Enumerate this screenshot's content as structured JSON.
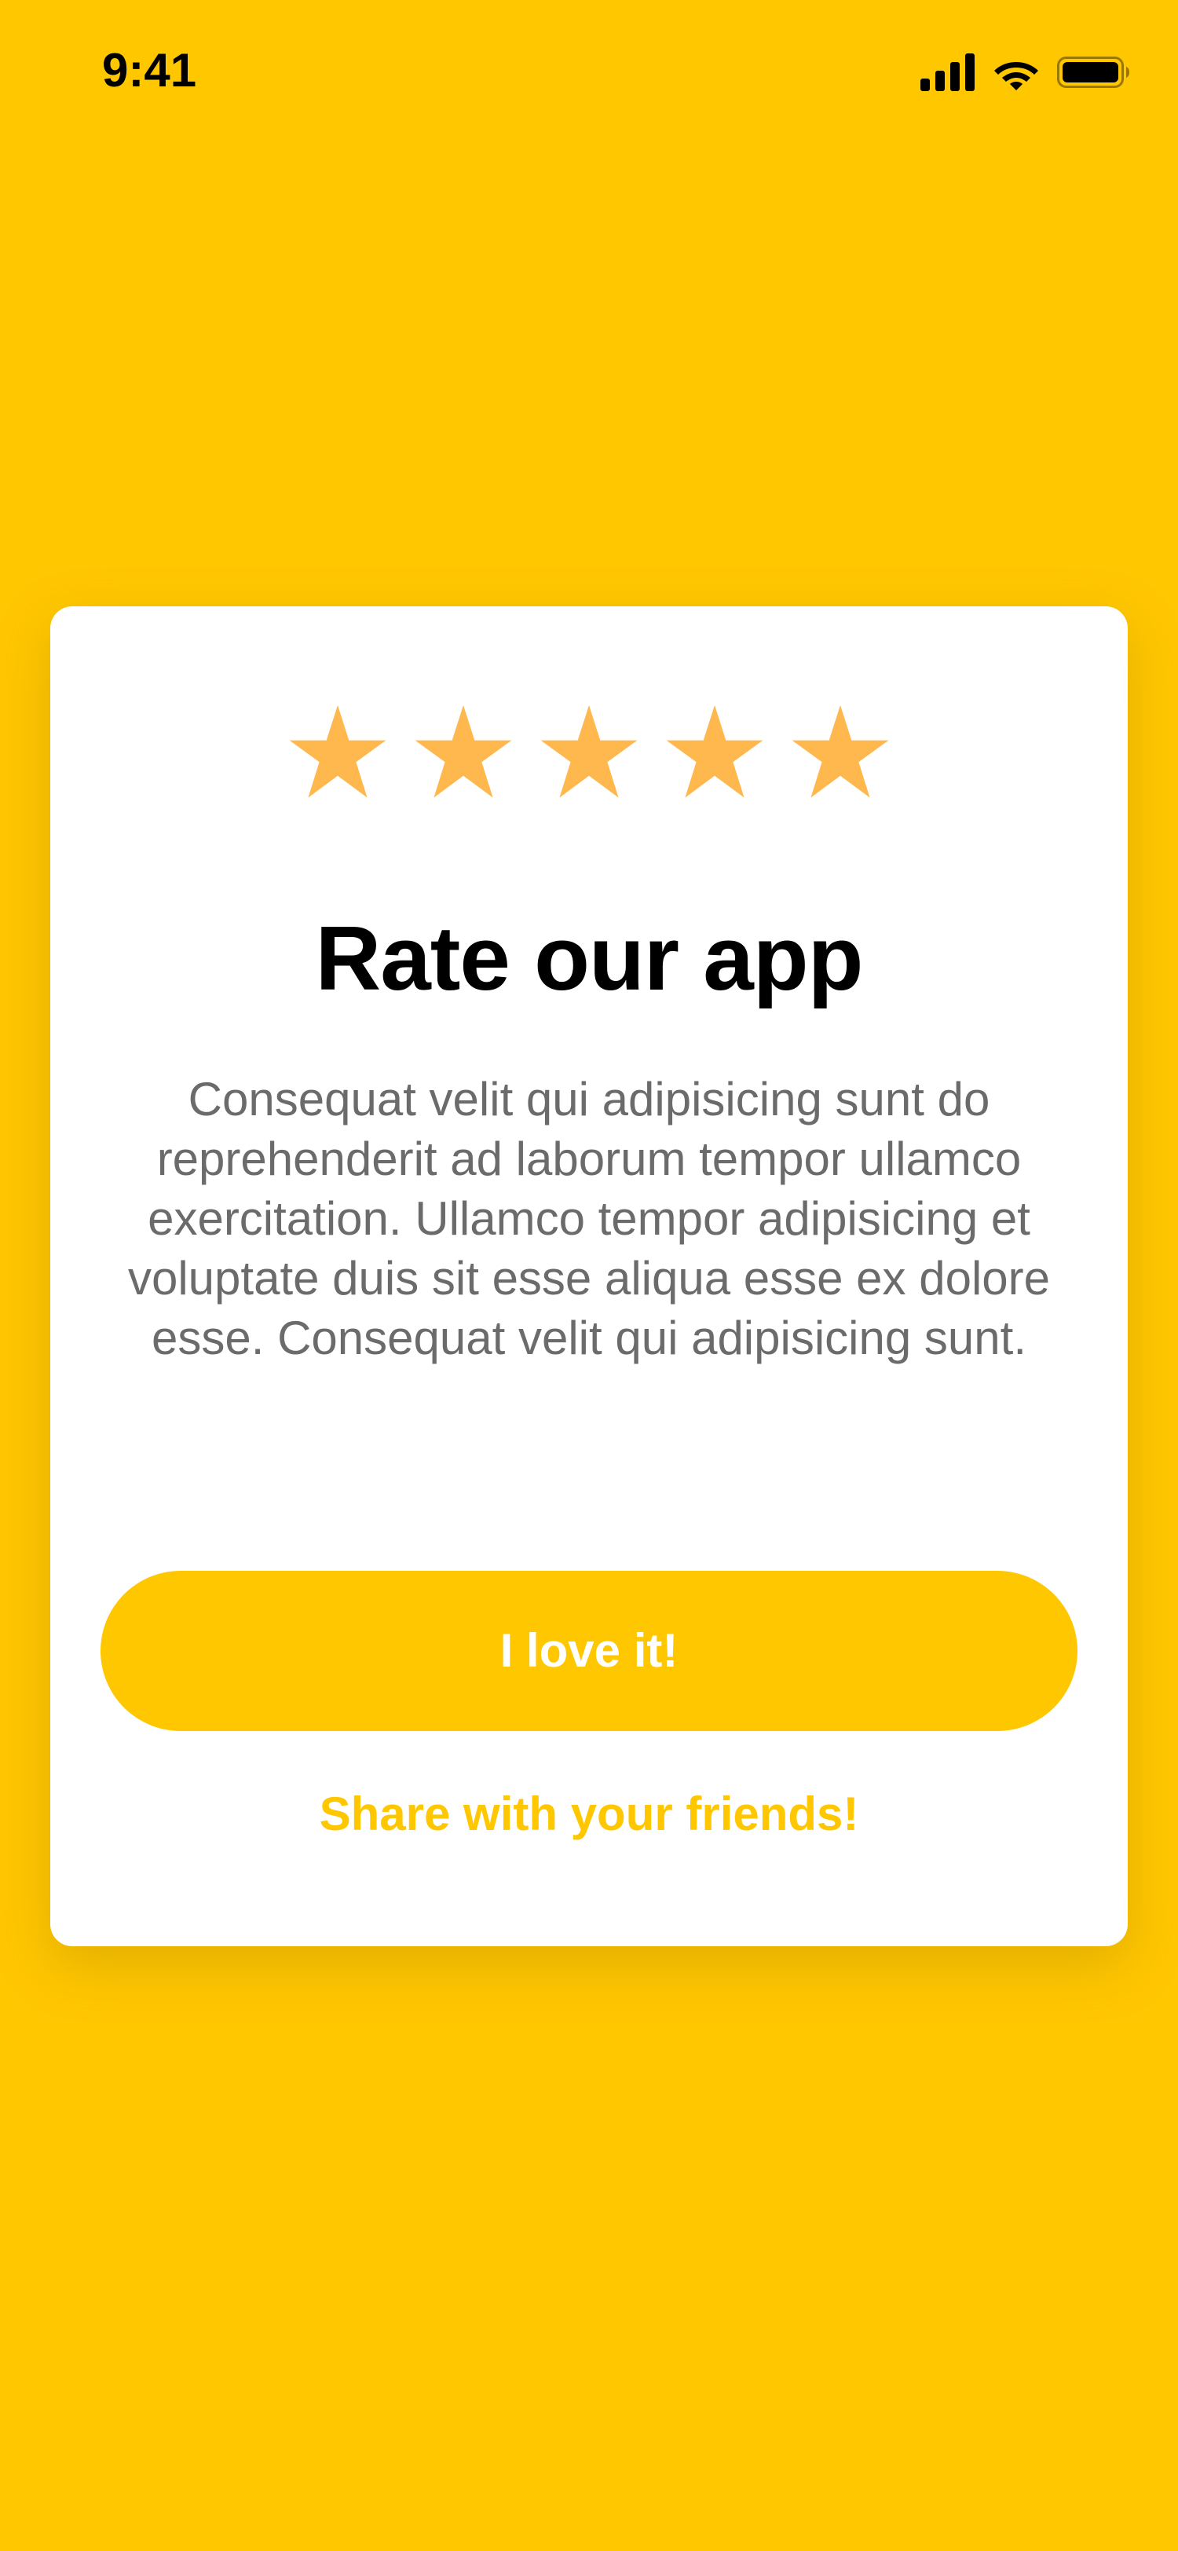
{
  "status_bar": {
    "time": "9:41",
    "icons": [
      "cellular-signal-icon",
      "wifi-icon",
      "battery-icon"
    ]
  },
  "rating": {
    "stars_filled": 5,
    "stars_total": 5,
    "star_color": "#FFB84D"
  },
  "card": {
    "title": "Rate our app",
    "body": "Consequat velit qui adipisicing sunt do reprehenderit ad laborum tempor ullamco exercitation. Ullamco tempor adipisicing et voluptate duis sit esse aliqua esse ex dolore esse. Consequat velit qui adipisicing sunt.",
    "primary_button": "I love it!",
    "secondary_link": "Share with your friends!"
  },
  "colors": {
    "background": "#FFC700",
    "card": "#FFFFFF",
    "accent": "#FFC700",
    "title": "#000000",
    "body_text": "#6B6B6B"
  }
}
